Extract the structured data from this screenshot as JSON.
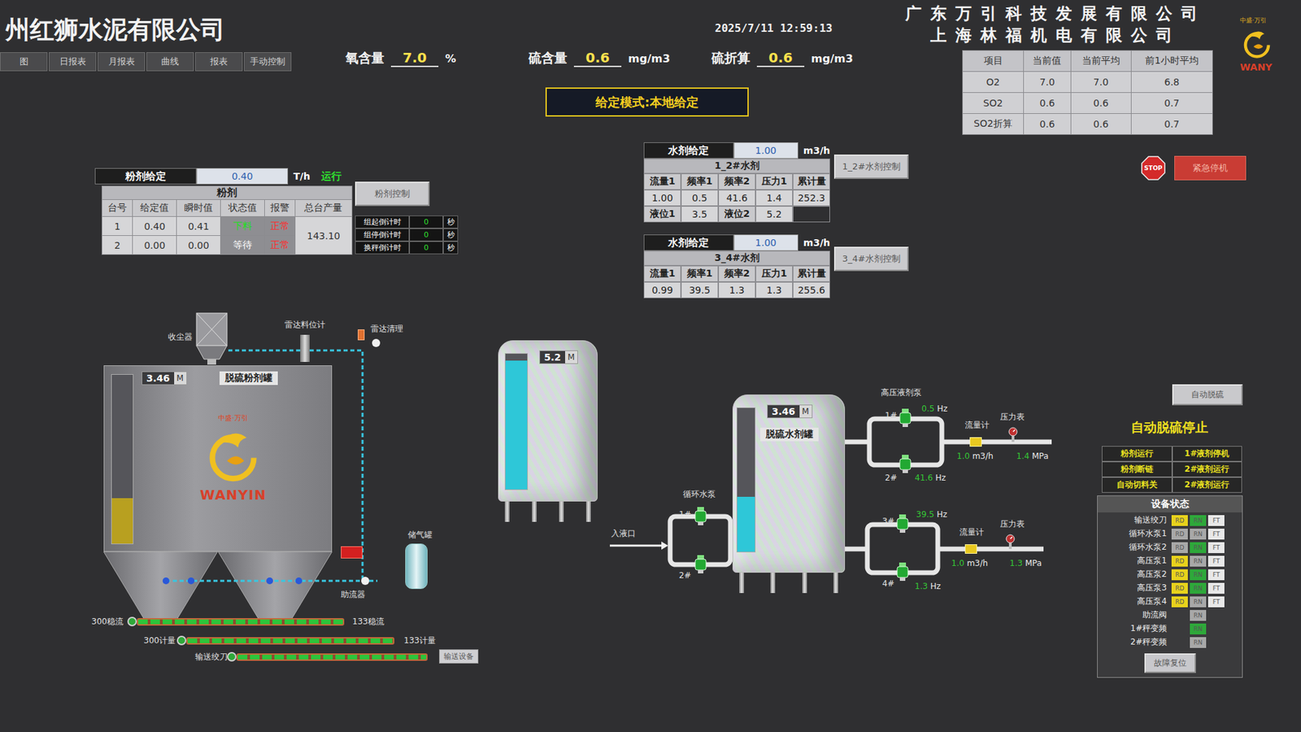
{
  "header": {
    "title": "州红狮水泥有限公司",
    "datetime": "2025/7/11 12:59:13",
    "companies": [
      "广东万引科技发展有限公司",
      "上海林福机电有限公司"
    ],
    "logo": {
      "brand": "中盛·万引",
      "name": "WANY"
    }
  },
  "tabs": [
    {
      "label": "图",
      "selected": false
    },
    {
      "label": "日报表",
      "selected": false
    },
    {
      "label": "月报表",
      "selected": false
    },
    {
      "label": "曲线",
      "selected": false
    },
    {
      "label": "报表",
      "selected": false
    },
    {
      "label": "手动控制",
      "selected": false
    }
  ],
  "readouts": [
    {
      "label": "氧含量",
      "value": "7.0",
      "unit": "%"
    },
    {
      "label": "硫含量",
      "value": "0.6",
      "unit": "mg/m3"
    },
    {
      "label": "硫折算",
      "value": "0.6",
      "unit": "mg/m3"
    }
  ],
  "summary": {
    "columns": [
      "项目",
      "当前值",
      "当前平均",
      "前1小时平均"
    ],
    "rows": [
      [
        "O2",
        "7.0",
        "7.0",
        "6.8"
      ],
      [
        "SO2",
        "0.6",
        "0.6",
        "0.7"
      ],
      [
        "SO2折算",
        "0.6",
        "0.6",
        "0.7"
      ]
    ]
  },
  "mode": "给定模式:本地给定",
  "emergency": {
    "icon": "STOP",
    "button": "紧急停机"
  },
  "powder": {
    "label": "粉剂给定",
    "value": "0.40",
    "unit": "T/h",
    "status": "运行",
    "button": "粉剂控制",
    "title": "粉剂",
    "columns": [
      "台号",
      "给定值",
      "瞬时值",
      "状态值",
      "报警",
      "总台产量"
    ],
    "rows": [
      {
        "id": "1",
        "set": "0.40",
        "actual": "0.41",
        "state": "下料",
        "active": true,
        "alarm": "正常"
      },
      {
        "id": "2",
        "set": "0.00",
        "actual": "0.00",
        "state": "等待",
        "active": false,
        "alarm": "正常"
      }
    ],
    "total": "143.10",
    "timers": [
      {
        "label": "组起倒计时",
        "value": "0",
        "unit": "秒"
      },
      {
        "label": "组停倒计时",
        "value": "0",
        "unit": "秒"
      },
      {
        "label": "换秤倒计时",
        "value": "0",
        "unit": "秒"
      }
    ]
  },
  "water": [
    {
      "label": "水剂给定",
      "value": "1.00",
      "unit": "m3/h",
      "title": "1_2#水剂",
      "button": "1_2#水剂控制",
      "columns": [
        "流量1",
        "频率1",
        "频率2",
        "压力1",
        "累计量"
      ],
      "values": [
        "1.00",
        "0.5",
        "41.6",
        "1.4",
        "252.3"
      ],
      "levels": [
        {
          "label": "液位1",
          "value": "3.5"
        },
        {
          "label": "液位2",
          "value": "5.2"
        }
      ]
    },
    {
      "label": "水剂给定",
      "value": "1.00",
      "unit": "m3/h",
      "title": "3_4#水剂",
      "button": "3_4#水剂控制",
      "columns": [
        "流量1",
        "频率1",
        "频率2",
        "压力1",
        "累计量"
      ],
      "values": [
        "0.99",
        "39.5",
        "1.3",
        "1.3",
        "255.6"
      ],
      "levels": []
    }
  ],
  "diagram": {
    "collector": "收尘器",
    "radar": "雷达料位计",
    "radarClean": "雷达清理",
    "airTank": "储气罐",
    "flowAid": "助流器",
    "powderTank": {
      "name": "脱硫粉剂罐",
      "reading": "3.46",
      "unit": "M",
      "level": 0.27,
      "brand": "中盛·万引",
      "logo": "WANYIN"
    },
    "screws": [
      {
        "left": "300稳流",
        "right": "133稳流"
      },
      {
        "left": "300计量",
        "right": "133计量"
      },
      {
        "left": "输送绞刀"
      }
    ],
    "conveyorButton": "输送设备",
    "bufferTank": {
      "reading": "5.2",
      "unit": "M",
      "level": 0.95
    },
    "waterTank": {
      "name": "脱硫水剂罐",
      "reading": "3.46",
      "unit": "M",
      "level": 0.38
    },
    "inlet": "入液口",
    "circulation": {
      "title": "循环水泵",
      "pumps": [
        {
          "label": "1#",
          "running": true
        },
        {
          "label": "2#",
          "running": true
        }
      ]
    },
    "lines": [
      {
        "title": "高压液剂泵",
        "pumps": [
          {
            "label": "1#",
            "freq": "0.5",
            "running": true
          },
          {
            "label": "2#",
            "freq": "41.6",
            "running": true
          }
        ],
        "meter": "流量计",
        "gauge": "压力表",
        "flow": "1.0",
        "pressure": "1.4"
      },
      {
        "pumps": [
          {
            "label": "3#",
            "freq": "39.5",
            "running": true
          },
          {
            "label": "4#",
            "freq": "1.3",
            "running": true
          }
        ],
        "meter": "流量计",
        "gauge": "压力表",
        "flow": "1.0",
        "pressure": "1.3"
      }
    ],
    "units": {
      "freq": "Hz",
      "flow": "m3/h",
      "pressure": "MPa"
    }
  },
  "auto": {
    "button": "自动脱硫",
    "status": "自动脱硫停止",
    "flags": [
      "粉剂运行",
      "1#液剂停机",
      "粉剂断链",
      "2#液剂运行",
      "自动切料关",
      "2#液剂运行"
    ]
  },
  "equipment": {
    "title": "设备状态",
    "button": "故障复位",
    "labels": {
      "rd": "RD",
      "rn": "RN",
      "ft": "FT"
    },
    "rows": [
      {
        "name": "输送绞刀",
        "kind": "full",
        "rd": true,
        "rn": true,
        "ft": false
      },
      {
        "name": "循环水泵1",
        "kind": "full",
        "rd": false,
        "rn": false,
        "ft": false
      },
      {
        "name": "循环水泵2",
        "kind": "full",
        "rd": false,
        "rn": true,
        "ft": false
      },
      {
        "name": "高压泵1",
        "kind": "full",
        "rd": true,
        "rn": false,
        "ft": false
      },
      {
        "name": "高压泵2",
        "kind": "full",
        "rd": true,
        "rn": true,
        "ft": false
      },
      {
        "name": "高压泵3",
        "kind": "full",
        "rd": true,
        "rn": true,
        "ft": false
      },
      {
        "name": "高压泵4",
        "kind": "full",
        "rd": true,
        "rn": false,
        "ft": false
      },
      {
        "name": "助流阀",
        "kind": "run",
        "rd": false,
        "rn": false,
        "ft": false
      },
      {
        "name": "1#秤变频",
        "kind": "run",
        "rd": false,
        "rn": true,
        "ft": false
      },
      {
        "name": "2#秤变频",
        "kind": "run",
        "rd": false,
        "rn": false,
        "ft": false
      }
    ]
  }
}
